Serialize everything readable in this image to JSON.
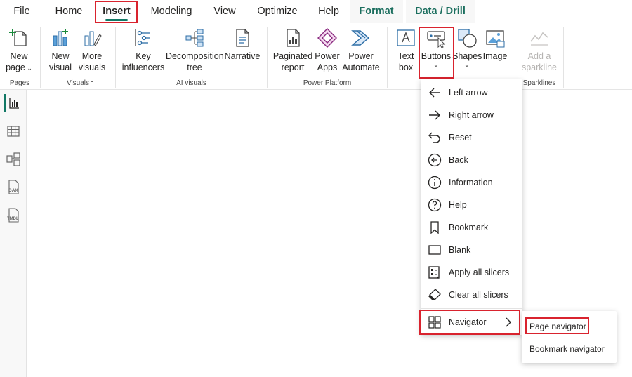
{
  "tabs": [
    {
      "label": "File"
    },
    {
      "label": "Home"
    },
    {
      "label": "Insert"
    },
    {
      "label": "Modeling"
    },
    {
      "label": "View"
    },
    {
      "label": "Optimize"
    },
    {
      "label": "Help"
    },
    {
      "label": "Format"
    },
    {
      "label": "Data / Drill"
    }
  ],
  "ribbon": {
    "buttons": {
      "new_page": {
        "line1": "New",
        "line2": "page"
      },
      "new_visual": {
        "line1": "New",
        "line2": "visual"
      },
      "more_visuals": {
        "line1": "More",
        "line2": "visuals"
      },
      "key_influencers": {
        "line1": "Key",
        "line2": "influencers"
      },
      "decomposition_tree": {
        "line1": "Decomposition",
        "line2": "tree"
      },
      "narrative": {
        "line1": "Narrative"
      },
      "paginated_report": {
        "line1": "Paginated",
        "line2": "report"
      },
      "power_apps": {
        "line1": "Power",
        "line2": "Apps"
      },
      "power_automate": {
        "line1": "Power",
        "line2": "Automate"
      },
      "text_box": {
        "line1": "Text",
        "line2": "box"
      },
      "buttons": {
        "line1": "Buttons"
      },
      "shapes": {
        "line1": "Shapes"
      },
      "image": {
        "line1": "Image"
      },
      "add_sparkline": {
        "line1": "Add a",
        "line2": "sparkline"
      }
    },
    "groups": {
      "pages": "Pages",
      "visuals": "Visuals",
      "ai_visuals": "AI visuals",
      "power_platform": "Power Platform",
      "sparklines": "Sparklines"
    }
  },
  "rail": {
    "items": [
      "report-view",
      "table-view",
      "model-view",
      "DAX",
      "TMDL"
    ]
  },
  "buttons_menu": {
    "items": [
      {
        "label": "Left arrow",
        "icon": "arrow-left-icon"
      },
      {
        "label": "Right arrow",
        "icon": "arrow-right-icon"
      },
      {
        "label": "Reset",
        "icon": "reset-icon"
      },
      {
        "label": "Back",
        "icon": "back-circle-icon"
      },
      {
        "label": "Information",
        "icon": "info-icon"
      },
      {
        "label": "Help",
        "icon": "help-icon"
      },
      {
        "label": "Bookmark",
        "icon": "bookmark-icon"
      },
      {
        "label": "Blank",
        "icon": "blank-icon"
      },
      {
        "label": "Apply all slicers",
        "icon": "apply-slicers-icon"
      },
      {
        "label": "Clear all slicers",
        "icon": "eraser-icon"
      },
      {
        "label": "Navigator",
        "icon": "navigator-grid-icon"
      }
    ]
  },
  "navigator_submenu": {
    "items": [
      {
        "label": "Page navigator"
      },
      {
        "label": "Bookmark navigator"
      }
    ]
  },
  "colors": {
    "accent": "#117865",
    "highlight": "#d9232e",
    "context_tab": "#1b6e5e"
  }
}
